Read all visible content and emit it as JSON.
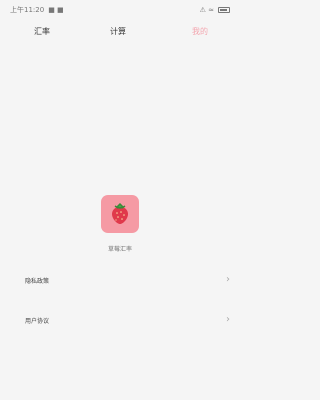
{
  "status_bar": {
    "time": "上午11:20",
    "signal_icons": "■ ■",
    "right_icons": "⚠ ≈"
  },
  "nav": {
    "left_label": "汇率",
    "center_label": "计算",
    "right_label": "我的"
  },
  "app": {
    "name": "草莓汇率",
    "logo_icon": "strawberry-icon"
  },
  "menu": {
    "privacy_label": "隐私政策",
    "user_agreement_label": "用户协议",
    "chevron": "›"
  },
  "colors": {
    "accent": "#f4a7b0",
    "logo_bg": "#f59aa4",
    "background": "#f5f5f5"
  }
}
